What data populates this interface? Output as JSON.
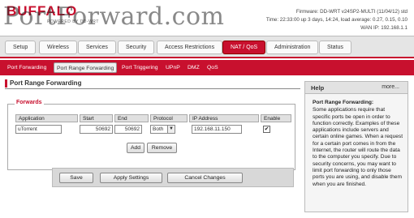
{
  "header": {
    "logo": "BUFFALO",
    "logo_sub": "POWERED BY DD-WRT",
    "watermark": "PortForward.com",
    "firmware": "Firmware: DD-WRT v24SP2-MULTI (11/04/12) std",
    "time": "Time: 22:33:00 up 3 days, 14:24, load average: 0.27, 0.15, 0.10",
    "wan": "WAN IP: 192.168.1.1"
  },
  "main_nav": [
    "Setup",
    "Wireless",
    "Services",
    "Security",
    "Access Restrictions",
    "NAT / QoS",
    "Administration",
    "Status"
  ],
  "sub_nav": [
    "Port Forwarding",
    "Port Range Forwarding",
    "Port Triggering",
    "UPnP",
    "DMZ",
    "QoS"
  ],
  "page": {
    "title": "Port Range Forwarding",
    "legend": "Forwards",
    "columns": [
      "Application",
      "Start",
      "End",
      "Protocol",
      "IP Address",
      "Enable"
    ],
    "row": {
      "application": "uTorrent",
      "start": "50692",
      "end": "50692",
      "protocol": "Both",
      "ip": "192.168.11.150",
      "enable_mark": "✔"
    },
    "add_label": "Add",
    "remove_label": "Remove",
    "save_label": "Save",
    "apply_label": "Apply Settings",
    "cancel_label": "Cancel Changes"
  },
  "help": {
    "title": "Help",
    "more": "more...",
    "heading": "Port Range Forwarding:",
    "text": "Some applications require that specific ports be open in order to function correctly. Examples of these applications include servers and certain online games. When a request for a certain port comes in from the Internet, the router will route the data to the computer you specify. Due to security concerns, you may want to limit port forwarding to only those ports you are using, and disable them when you are finished."
  },
  "colors": {
    "accent": "#c8102e"
  }
}
